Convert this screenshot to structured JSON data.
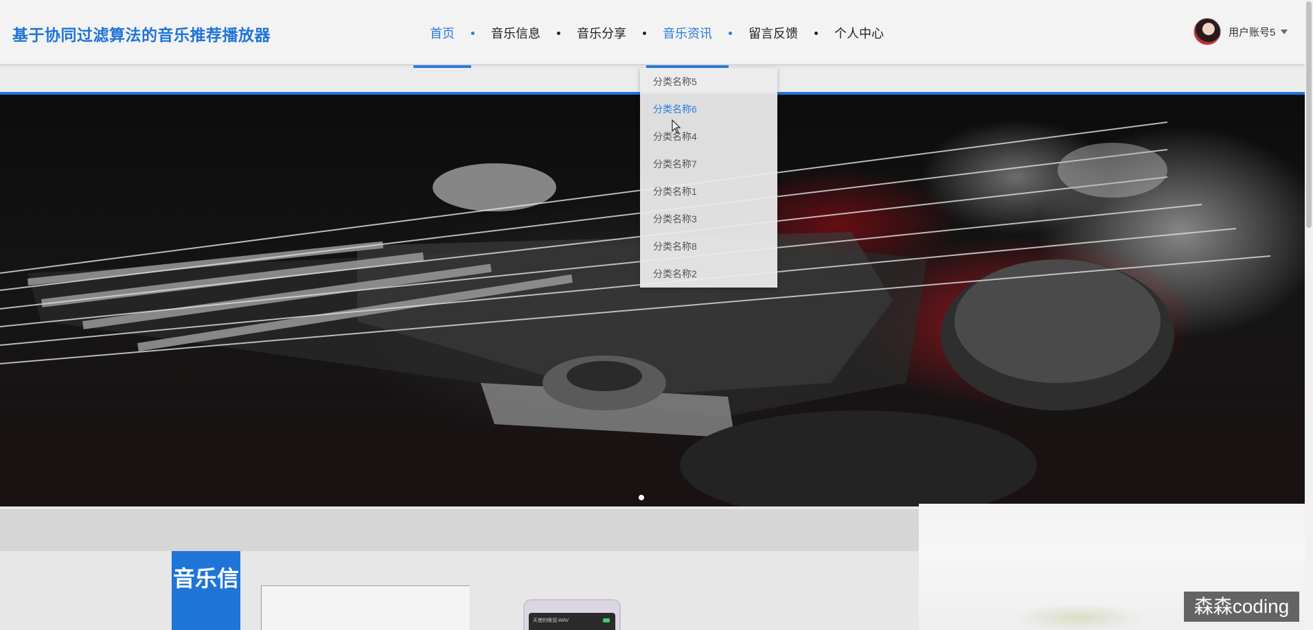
{
  "header": {
    "site_title": "基于协同过滤算法的音乐推荐播放器",
    "nav": [
      {
        "label": "首页",
        "active": true
      },
      {
        "label": "音乐信息",
        "active": false
      },
      {
        "label": "音乐分享",
        "active": false
      },
      {
        "label": "音乐资讯",
        "active": true
      },
      {
        "label": "留言反馈",
        "active": false
      },
      {
        "label": "个人中心",
        "active": false
      }
    ],
    "user": {
      "name": "用户账号5"
    }
  },
  "dropdown": {
    "items": [
      "分类名称5",
      "分类名称6",
      "分类名称4",
      "分类名称7",
      "分类名称1",
      "分类名称3",
      "分类名称8",
      "分类名称2"
    ],
    "hovered": "分类名称6"
  },
  "section": {
    "tag": "音乐信"
  },
  "device": {
    "screen_text": "天使的眼泪.WAV"
  },
  "watermark": "森森coding",
  "colors": {
    "accent": "#1f74d8",
    "nav_active": "#2b7bdc"
  }
}
